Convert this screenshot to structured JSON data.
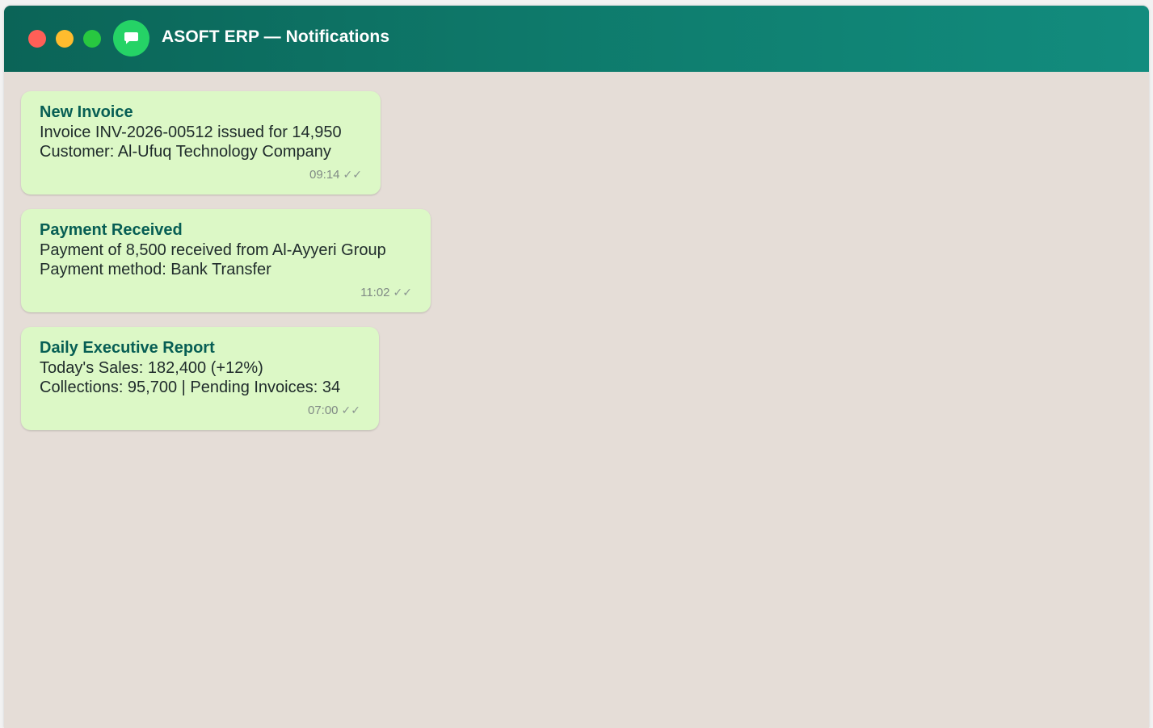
{
  "window": {
    "title": "ASOFT ERP — Notifications"
  },
  "colors": {
    "header_start": "#0b6457",
    "header_end": "#128c7e",
    "app_icon": "#25d366",
    "bubble_bg": "#dcf8c6",
    "bubble_title": "#075e54",
    "chat_bg": "#e5ddd7"
  },
  "icons": {
    "app": "chat-bubble-icon",
    "read_receipt": "double-check-icon"
  },
  "messages": [
    {
      "title": "New Invoice",
      "lines": [
        "Invoice INV-2026-00512 issued for 14,950",
        "Customer: Al-Ufuq Technology Company"
      ],
      "time": "09:14",
      "status": "✓✓"
    },
    {
      "title": "Payment Received",
      "lines": [
        "Payment of 8,500 received from Al-Ayyeri Group",
        "Payment method: Bank Transfer"
      ],
      "time": "11:02",
      "status": "✓✓"
    },
    {
      "title": "Daily Executive Report",
      "lines": [
        "Today's Sales: 182,400 (+12%)",
        "Collections: 95,700 | Pending Invoices: 34"
      ],
      "time": "07:00",
      "status": "✓✓"
    }
  ]
}
